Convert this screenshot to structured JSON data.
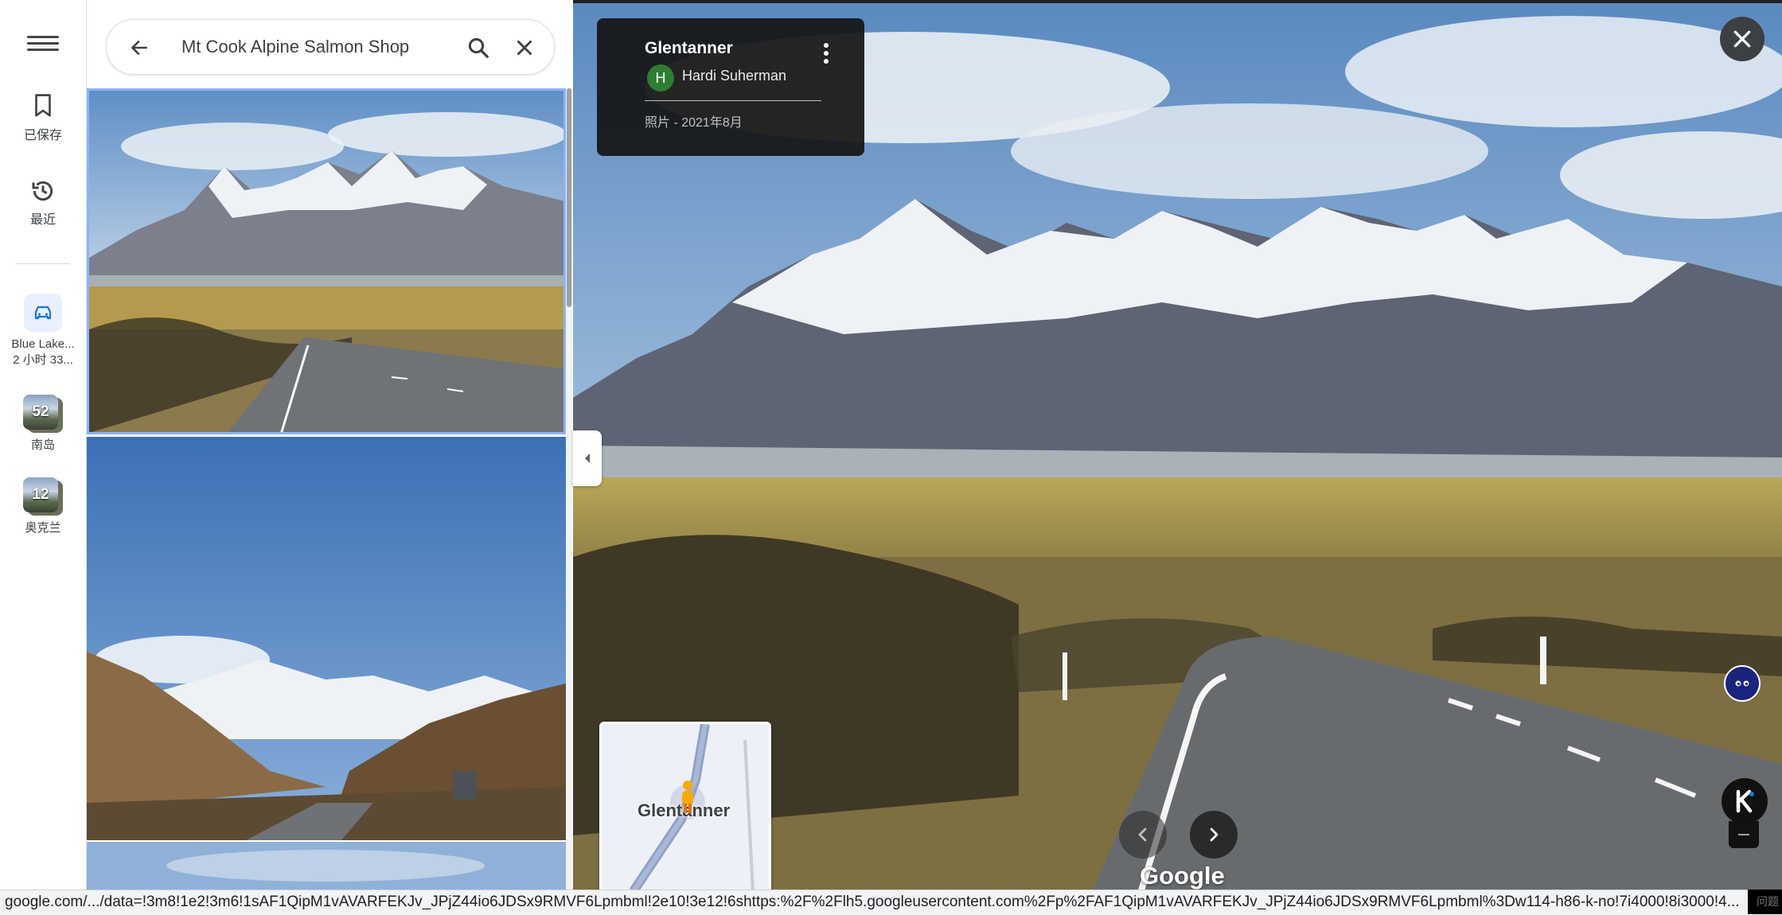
{
  "rail": {
    "saved_label": "已保存",
    "recent_label": "最近",
    "trips": [
      {
        "label_line1": "Blue Lake...",
        "label_line2": "2 小时 33..."
      },
      {
        "count": "52",
        "label": "南岛"
      },
      {
        "count": "12",
        "label": "奥克兰"
      }
    ]
  },
  "search": {
    "query": "Mt Cook Alpine Salmon Shop"
  },
  "viewer": {
    "title": "Glentanner",
    "author_initial": "H",
    "author": "Hardi Suherman",
    "meta": "照片 - 2021年8月",
    "minimap_label": "Glentanner",
    "logo": "Google"
  },
  "status_bar": {
    "url": "google.com/.../data=!3m8!1e2!3m6!1sAF1QipM1vAVARFEKJv_JPjZ44io6JDSx9RMVF6Lpmbml!2e10!3e12!6shttps:%2F%2Flh5.googleusercontent.com%2Fp%2FAF1QipM1vAVARFEKJv_JPjZ44io6JDSx9RMVF6Lpmbml%3Dw114-h86-k-no!7i4000!8i3000!4...",
    "corner": "问题"
  },
  "colors": {
    "accent_blue": "#8ab4f8",
    "card_bg": "#141414",
    "avatar_green": "#2e7d32"
  }
}
